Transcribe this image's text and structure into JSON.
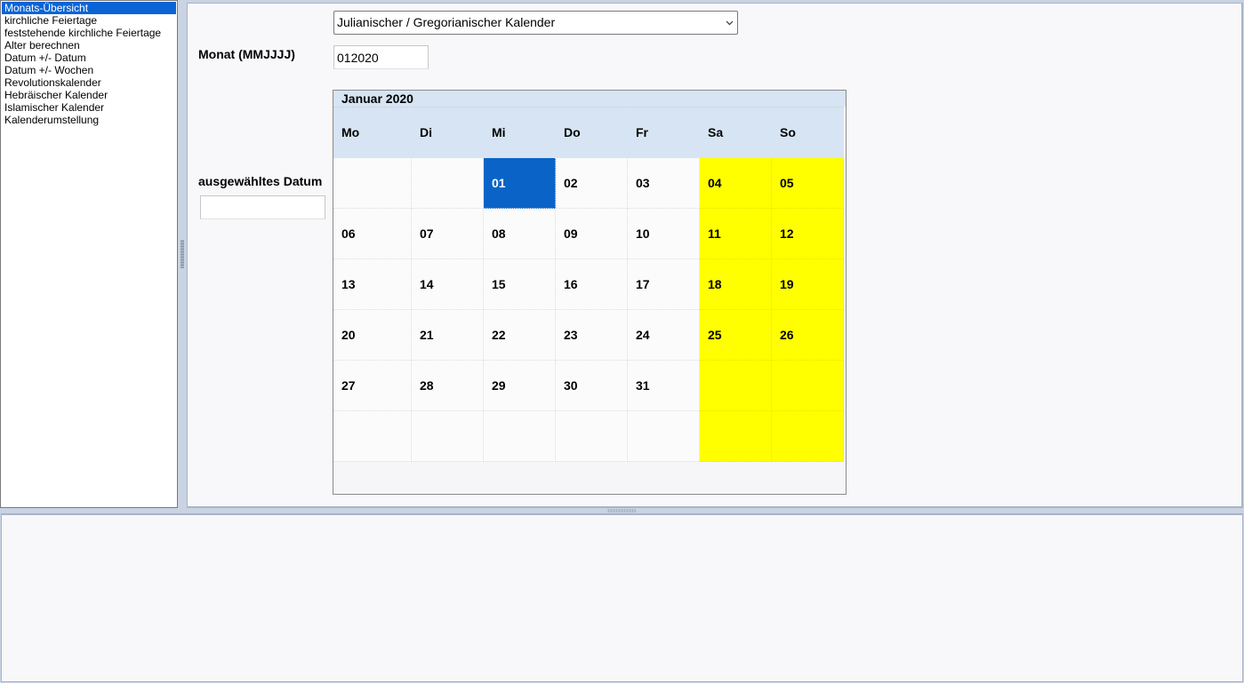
{
  "sidebar": {
    "items": [
      {
        "label": "Monats-Übersicht",
        "selected": true
      },
      {
        "label": "kirchliche Feiertage"
      },
      {
        "label": "feststehende kirchliche Feiertage"
      },
      {
        "label": "Alter berechnen"
      },
      {
        "label": "Datum +/- Datum"
      },
      {
        "label": "Datum +/- Wochen"
      },
      {
        "label": "Revolutionskalender"
      },
      {
        "label": "Hebräischer Kalender"
      },
      {
        "label": "Islamischer Kalender"
      },
      {
        "label": "Kalenderumstellung"
      }
    ]
  },
  "form": {
    "calendar_select_value": "Julianischer / Gregorianischer Kalender",
    "month_label": "Monat (MMJJJJ)",
    "month_value": "012020",
    "selected_date_label": "ausgewähltes Datum",
    "selected_date_value": ""
  },
  "calendar": {
    "title": "Januar 2020",
    "weekdays": [
      "Mo",
      "Di",
      "Mi",
      "Do",
      "Fr",
      "Sa",
      "So"
    ],
    "weekend_color": "#ffff00",
    "selected_color": "#0a64c8",
    "selected_day": "01",
    "weeks": [
      [
        "",
        "",
        "01",
        "02",
        "03",
        "04",
        "05"
      ],
      [
        "06",
        "07",
        "08",
        "09",
        "10",
        "11",
        "12"
      ],
      [
        "13",
        "14",
        "15",
        "16",
        "17",
        "18",
        "19"
      ],
      [
        "20",
        "21",
        "22",
        "23",
        "24",
        "25",
        "26"
      ],
      [
        "27",
        "28",
        "29",
        "30",
        "31",
        "",
        ""
      ],
      [
        "",
        "",
        "",
        "",
        "",
        "",
        ""
      ]
    ]
  }
}
